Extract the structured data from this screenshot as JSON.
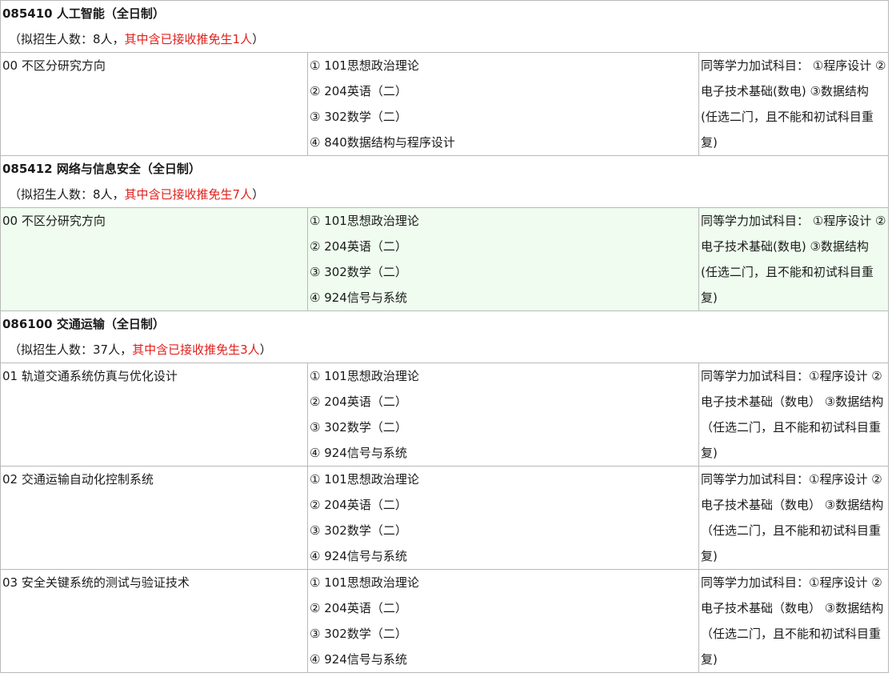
{
  "sections": [
    {
      "title": "085410 人工智能（全日制）",
      "enroll_prefix": "（拟招生人数：8人，",
      "enroll_exempt": "其中含已接收推免生1人",
      "enroll_suffix": "）",
      "rows": [
        {
          "direction": "00 不区分研究方向",
          "subjects": [
            "① 101思想政治理论",
            "② 204英语（二）",
            "③ 302数学（二）",
            "④ 840数据结构与程序设计"
          ],
          "extra": "同等学力加试科目： ①程序设计 ②电子技术基础(数电) ③数据结构 (任选二门，且不能和初试科目重复)"
        }
      ]
    },
    {
      "title": "085412 网络与信息安全（全日制）",
      "enroll_prefix": "（拟招生人数：8人，",
      "enroll_exempt": "其中含已接收推免生7人",
      "enroll_suffix": "）",
      "rows": [
        {
          "direction": "00 不区分研究方向",
          "subjects": [
            "① 101思想政治理论",
            "② 204英语（二）",
            "③ 302数学（二）",
            "④ 924信号与系统"
          ],
          "extra": "同等学力加试科目： ①程序设计 ②电子技术基础(数电) ③数据结构 (任选二门，且不能和初试科目重复)"
        }
      ]
    },
    {
      "title": "086100 交通运输（全日制）",
      "enroll_prefix": "（拟招生人数：37人，",
      "enroll_exempt": "其中含已接收推免生3人",
      "enroll_suffix": "）",
      "rows": [
        {
          "direction": "01 轨道交通系统仿真与优化设计",
          "subjects": [
            "① 101思想政治理论",
            "② 204英语（二）",
            "③ 302数学（二）",
            "④ 924信号与系统"
          ],
          "extra": "同等学力加试科目：①程序设计 ②电子技术基础（数电） ③数据结构 （任选二门，且不能和初试科目重复)"
        },
        {
          "direction": "02 交通运输自动化控制系统",
          "subjects": [
            "① 101思想政治理论",
            "② 204英语（二）",
            "③ 302数学（二）",
            "④ 924信号与系统"
          ],
          "extra": "同等学力加试科目：①程序设计 ②电子技术基础（数电） ③数据结构 （任选二门，且不能和初试科目重复)"
        },
        {
          "direction": "03 安全关键系统的测试与验证技术",
          "subjects": [
            "① 101思想政治理论",
            "② 204英语（二）",
            "③ 302数学（二）",
            "④ 924信号与系统"
          ],
          "extra": "同等学力加试科目：①程序设计 ②电子技术基础（数电） ③数据结构 （任选二门，且不能和初试科目重复)"
        }
      ]
    }
  ]
}
